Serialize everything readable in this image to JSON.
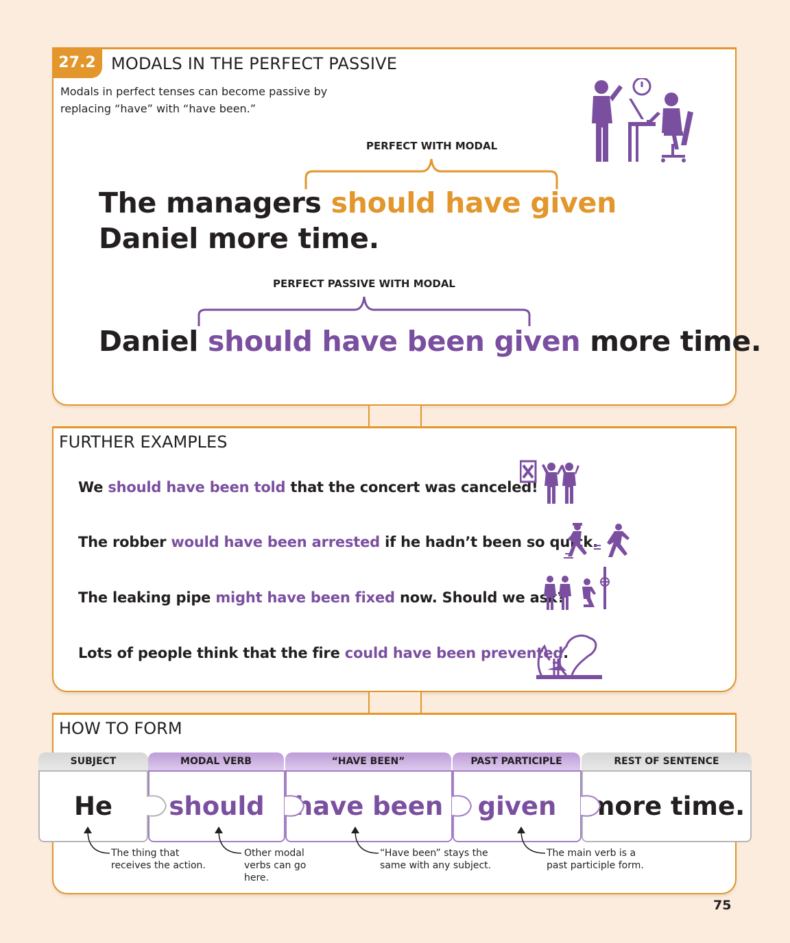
{
  "section": {
    "number": "27.2",
    "title": "MODALS IN THE PERFECT PASSIVE",
    "intro": "Modals in perfect tenses can become passive by replacing “have” with “have been.”"
  },
  "main": {
    "label1": "PERFECT WITH MODAL",
    "sentence1": {
      "before": "The managers ",
      "highlight": "should have given",
      "line2": "Daniel more time."
    },
    "label2": "PERFECT PASSIVE WITH MODAL",
    "sentence2": {
      "before": "Daniel ",
      "highlight": "should have been given",
      "after": " more time."
    }
  },
  "further": {
    "heading": "FURTHER EXAMPLES",
    "examples": [
      {
        "before": "We ",
        "highlight": "should have been told",
        "after": " that the concert was canceled!"
      },
      {
        "before": "The robber ",
        "highlight": "would have been arrested",
        "after": " if he hadn’t been so quick."
      },
      {
        "before": "The leaking pipe ",
        "highlight": "might have been fixed",
        "after": " now. Should we ask?"
      },
      {
        "before": "Lots of people think that the fire ",
        "highlight": "could have been prevented",
        "after": "."
      }
    ]
  },
  "form": {
    "heading": "HOW TO FORM",
    "columns": [
      {
        "header": "SUBJECT",
        "value": "He",
        "note": "The thing that receives the action."
      },
      {
        "header": "MODAL VERB",
        "value": "should",
        "note": "Other modal verbs can go here."
      },
      {
        "header": "“HAVE BEEN”",
        "value": "have been",
        "note": "“Have been” stays the same with any subject."
      },
      {
        "header": "PAST PARTICIPLE",
        "value": "given",
        "note": "The main verb is a past participle form."
      },
      {
        "header": "REST OF SENTENCE",
        "value": "more time.",
        "note": ""
      }
    ]
  },
  "page_number": "75",
  "colors": {
    "orange": "#e2962b",
    "purple": "#7b4fa0",
    "background": "#fcecdd"
  }
}
